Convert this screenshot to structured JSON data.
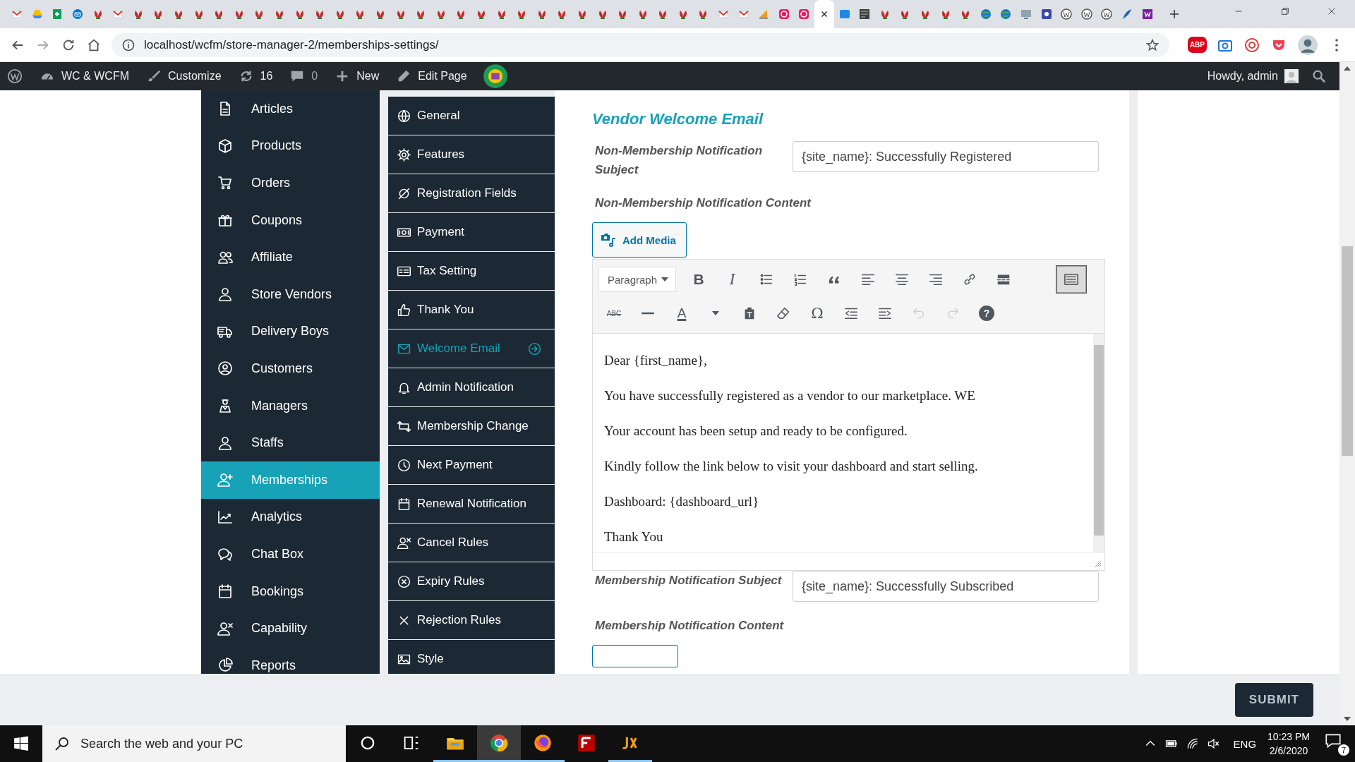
{
  "browser": {
    "tabs": [
      {
        "kind": "gmail",
        "selected": false
      },
      {
        "kind": "drive",
        "selected": false
      },
      {
        "kind": "sheets",
        "selected": false
      },
      {
        "kind": "mail",
        "selected": false
      },
      {
        "kind": "site",
        "selected": false
      },
      {
        "kind": "gmail",
        "selected": false
      },
      {
        "kind": "site",
        "selected": false
      },
      {
        "kind": "site",
        "selected": false
      },
      {
        "kind": "site",
        "selected": false
      },
      {
        "kind": "site",
        "selected": false
      },
      {
        "kind": "site",
        "selected": false
      },
      {
        "kind": "site",
        "selected": false
      },
      {
        "kind": "site",
        "selected": false
      },
      {
        "kind": "site",
        "selected": false
      },
      {
        "kind": "site",
        "selected": false
      },
      {
        "kind": "site",
        "selected": false
      },
      {
        "kind": "site",
        "selected": false
      },
      {
        "kind": "site",
        "selected": false
      },
      {
        "kind": "site",
        "selected": false
      },
      {
        "kind": "site",
        "selected": false
      },
      {
        "kind": "site",
        "selected": false
      },
      {
        "kind": "site",
        "selected": false
      },
      {
        "kind": "site",
        "selected": false
      },
      {
        "kind": "site",
        "selected": false
      },
      {
        "kind": "site",
        "selected": false
      },
      {
        "kind": "site",
        "selected": false
      },
      {
        "kind": "site",
        "selected": false
      },
      {
        "kind": "site",
        "selected": false
      },
      {
        "kind": "site",
        "selected": false
      },
      {
        "kind": "site",
        "selected": false
      },
      {
        "kind": "site",
        "selected": false
      },
      {
        "kind": "site",
        "selected": false
      },
      {
        "kind": "site",
        "selected": false
      },
      {
        "kind": "site",
        "selected": false
      },
      {
        "kind": "site",
        "selected": false
      },
      {
        "kind": "gmail",
        "selected": false
      },
      {
        "kind": "gmail",
        "selected": false
      },
      {
        "kind": "pma",
        "selected": false
      },
      {
        "kind": "pink",
        "selected": false
      },
      {
        "kind": "pink",
        "selected": false
      },
      {
        "selected": true
      },
      {
        "kind": "ibb",
        "selected": false
      },
      {
        "kind": "dark",
        "selected": false
      },
      {
        "kind": "site",
        "selected": false
      },
      {
        "kind": "site",
        "selected": false
      },
      {
        "kind": "site",
        "selected": false
      },
      {
        "kind": "site",
        "selected": false
      },
      {
        "kind": "site",
        "selected": false
      },
      {
        "kind": "globe",
        "selected": false
      },
      {
        "kind": "globe",
        "selected": false
      },
      {
        "kind": "screen",
        "selected": false
      },
      {
        "kind": "square",
        "selected": false
      },
      {
        "kind": "wp",
        "selected": false
      },
      {
        "kind": "wp",
        "selected": false
      },
      {
        "kind": "wp",
        "selected": false
      },
      {
        "kind": "feather",
        "selected": false
      },
      {
        "kind": "purple",
        "selected": false
      }
    ],
    "address": "localhost/wcfm/store-manager-2/memberships-settings/",
    "extensions": [
      {
        "kind": "abp",
        "label": "ABP"
      },
      {
        "kind": "camera"
      },
      {
        "kind": "swirl"
      },
      {
        "kind": "pocket"
      }
    ]
  },
  "admin_bar": {
    "site": "WC & WCFM",
    "customize": "Customize",
    "updates": "16",
    "comments": "0",
    "new": "New",
    "edit": "Edit Page",
    "greeting": "Howdy, admin"
  },
  "sidebar": {
    "items": [
      {
        "label": "Articles",
        "kind": "document",
        "selected": false
      },
      {
        "label": "Products",
        "kind": "box",
        "selected": false
      },
      {
        "label": "Orders",
        "kind": "cart",
        "selected": false
      },
      {
        "label": "Coupons",
        "kind": "gift",
        "selected": false
      },
      {
        "label": "Affiliate",
        "kind": "users",
        "selected": false
      },
      {
        "label": "Store Vendors",
        "kind": "user",
        "selected": false
      },
      {
        "label": "Delivery Boys",
        "kind": "truck",
        "selected": false
      },
      {
        "label": "Customers",
        "kind": "user-circle",
        "selected": false
      },
      {
        "label": "Managers",
        "kind": "manager",
        "selected": false
      },
      {
        "label": "Staffs",
        "kind": "user",
        "selected": false
      },
      {
        "label": "Memberships",
        "kind": "user-plus",
        "selected": true
      },
      {
        "label": "Analytics",
        "kind": "chart",
        "selected": false
      },
      {
        "label": "Chat Box",
        "kind": "chat",
        "selected": false
      },
      {
        "label": "Bookings",
        "kind": "calendar",
        "selected": false
      },
      {
        "label": "Capability",
        "kind": "user-x",
        "selected": false
      },
      {
        "label": "Reports",
        "kind": "pie",
        "selected": false
      }
    ]
  },
  "settings_menu": {
    "items": [
      {
        "label": "General",
        "kind": "globe",
        "selected": false
      },
      {
        "label": "Features",
        "kind": "gear",
        "selected": false
      },
      {
        "label": "Registration Fields",
        "kind": "ring",
        "selected": false
      },
      {
        "label": "Payment",
        "kind": "money",
        "selected": false
      },
      {
        "label": "Tax Setting",
        "kind": "card",
        "selected": false
      },
      {
        "label": "Thank You",
        "kind": "thumbs",
        "selected": false
      },
      {
        "label": "Welcome Email",
        "kind": "envelope",
        "selected": true
      },
      {
        "label": "Admin Notification",
        "kind": "bell",
        "selected": false
      },
      {
        "label": "Membership Change",
        "kind": "arrows",
        "selected": false
      },
      {
        "label": "Next Payment",
        "kind": "clock",
        "selected": false
      },
      {
        "label": "Renewal Notification",
        "kind": "calendar",
        "selected": false
      },
      {
        "label": "Cancel Rules",
        "kind": "user-x",
        "selected": false
      },
      {
        "label": "Expiry Rules",
        "kind": "circle-x",
        "selected": false
      },
      {
        "label": "Rejection Rules",
        "kind": "x",
        "selected": false
      },
      {
        "label": "Style",
        "kind": "image",
        "selected": false
      }
    ]
  },
  "form": {
    "title": "Vendor Welcome Email",
    "fields": [
      {
        "kind": "text",
        "label": "Non-Membership Notification Subject",
        "value": "{site_name}: Successfully Registered"
      },
      {
        "kind": "editor",
        "label": "Non-Membership Notification Content",
        "button": "Add Media",
        "toolbar": [
          [
            {
              "kind": "format",
              "text": "Paragraph",
              "pressed": false,
              "disabled": false
            },
            {
              "kind": "bold",
              "text": "B",
              "pressed": false,
              "disabled": false
            },
            {
              "kind": "italic",
              "text": "I",
              "pressed": false,
              "disabled": false
            },
            {
              "kind": "bullets",
              "pressed": false,
              "disabled": false
            },
            {
              "kind": "numbers",
              "pressed": false,
              "disabled": false
            },
            {
              "kind": "quote",
              "pressed": false,
              "disabled": false
            },
            {
              "kind": "align-left",
              "pressed": false,
              "disabled": false
            },
            {
              "kind": "align-center",
              "pressed": false,
              "disabled": false
            },
            {
              "kind": "align-right",
              "pressed": false,
              "disabled": false
            },
            {
              "kind": "link",
              "pressed": false,
              "disabled": false
            },
            {
              "kind": "more",
              "pressed": false,
              "disabled": false
            },
            {
              "kind": "keyboard",
              "pressed": true,
              "disabled": false
            }
          ],
          [
            {
              "kind": "strike",
              "text": "ABC",
              "pressed": false,
              "disabled": false
            },
            {
              "kind": "hr",
              "pressed": false,
              "disabled": false
            },
            {
              "kind": "color",
              "text": "A",
              "pressed": false,
              "disabled": false
            },
            {
              "kind": "caret",
              "pressed": false,
              "disabled": false
            },
            {
              "kind": "paste",
              "pressed": false,
              "disabled": false
            },
            {
              "kind": "eraser",
              "pressed": false,
              "disabled": false
            },
            {
              "kind": "char",
              "text": "Ω",
              "pressed": false,
              "disabled": false
            },
            {
              "kind": "outdent",
              "pressed": false,
              "disabled": false
            },
            {
              "kind": "indent",
              "pressed": false,
              "disabled": false
            },
            {
              "kind": "undo",
              "pressed": false,
              "disabled": true
            },
            {
              "kind": "redo",
              "pressed": false,
              "disabled": true
            },
            {
              "kind": "help",
              "text": "?",
              "pressed": false,
              "disabled": false
            }
          ]
        ],
        "paragraphs": [
          "Dear {first_name},",
          "You have successfully registered as a vendor to our marketplace.  WE",
          "Your account has been setup and ready to be configured.",
          "Kindly follow the link below to visit your dashboard and start selling.",
          "Dashboard: {dashboard_url}",
          "Thank You"
        ]
      },
      {
        "kind": "text",
        "label": "Membership Notification Subject",
        "value": "{site_name}: Successfully Subscribed"
      },
      {
        "kind": "editor_cut",
        "label": "Membership Notification Content"
      }
    ]
  },
  "submit": "SUBMIT",
  "taskbar": {
    "search_placeholder": "Search the web and your PC",
    "apps": [
      {
        "kind": "explorer",
        "selected": false,
        "running": true
      },
      {
        "kind": "chrome",
        "selected": true,
        "running": true
      },
      {
        "kind": "firefox",
        "selected": false,
        "running": true
      },
      {
        "kind": "filezilla",
        "selected": false,
        "running": false
      },
      {
        "kind": "jedit",
        "selected": false,
        "running": true
      }
    ],
    "language": "ENG",
    "time": "10:23 PM",
    "date": "2/6/2020",
    "notifications": "7"
  }
}
